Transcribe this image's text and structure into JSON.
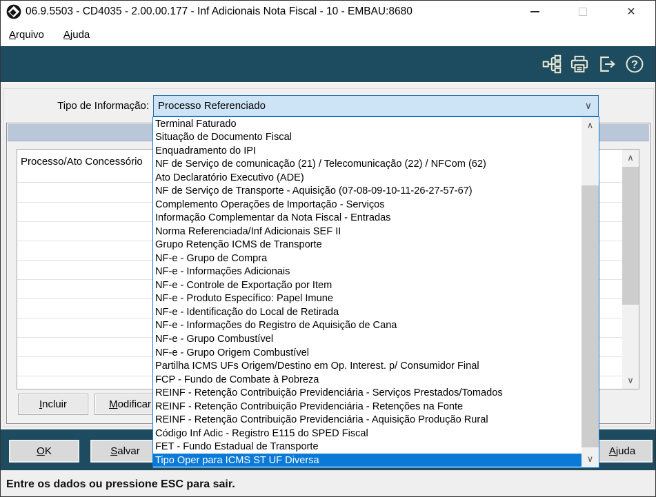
{
  "window": {
    "title": "06.9.5503 - CD4035 - 2.00.00.177 - Inf Adicionais Nota Fiscal - 10 - EMBAU:8680",
    "logo_icon": "totvs-logo-icon",
    "titlebar_icons": [
      "minimize-icon",
      "maximize-icon",
      "close-icon"
    ],
    "close_glyph": "×"
  },
  "menu": {
    "items": [
      {
        "label": "Arquivo"
      },
      {
        "label": "Ajuda"
      }
    ]
  },
  "toolbar": {
    "icons": [
      "program-tree-icon",
      "print-icon",
      "exit-icon",
      "help-icon"
    ],
    "help_glyph": "?"
  },
  "form": {
    "field_label": "Tipo de Informação:",
    "combo": {
      "value": "Processo Referenciado",
      "chevron_glyph": "∨"
    },
    "table": {
      "column_header": "Processo/Ato Concessório"
    },
    "actions": {
      "incluir": "Incluir",
      "modificar": "Modificar"
    }
  },
  "dropdown": {
    "items": [
      "Terminal Faturado",
      "Situação de Documento Fiscal",
      "Enquadramento do IPI",
      "NF de Serviço de comunicação (21) / Telecomunicação (22) / NFCom (62)",
      "Ato Declaratório Executivo (ADE)",
      "NF de Serviço de Transporte - Aquisição (07-08-09-10-11-26-27-57-67)",
      "Complemento Operações de Importação - Serviços",
      "Informação Complementar da Nota Fiscal - Entradas",
      "Norma Referenciada/Inf Adicionais SEF II",
      "Grupo Retenção ICMS de Transporte",
      "NF-e - Grupo de Compra",
      "NF-e - Informações Adicionais",
      "NF-e - Controle de Exportação por Item",
      "NF-e - Produto Específico: Papel Imune",
      "NF-e - Identificação do Local de Retirada",
      "NF-e - Informações do Registro de Aquisição de Cana",
      "NF-e - Grupo Combustível",
      "NF-e - Grupo Origem Combustível",
      "Partilha ICMS UFs Origem/Destino em Op. Interest. p/ Consumidor Final",
      "FCP - Fundo de Combate à Pobreza",
      "REINF - Retenção Contribuição Previdenciária - Serviços Prestados/Tomados",
      "REINF - Retenção Contribuição Previdenciária - Retenções na Fonte",
      "REINF - Retenção Contribuição Previdenciária - Aquisição Produção Rural",
      "Código Inf Adic - Registro E115 do SPED Fiscal",
      "FET - Fundo Estadual de Transporte",
      "Tipo Oper para ICMS ST UF Diversa"
    ],
    "selected_index": 25,
    "selected_value": "Tipo Oper para ICMS ST UF Diversa",
    "scroll_up_glyph": "∧",
    "scroll_down_glyph": "∨"
  },
  "footer": {
    "ok": "OK",
    "salvar": "Salvar",
    "ajuda": "Ajuda"
  },
  "statusbar": {
    "message": "Entre os dados ou pressione ESC para sair."
  },
  "colors": {
    "band_teal": "#1d4b5f",
    "icon_cream": "#ecead6",
    "combo_fill": "#cde4f7",
    "combo_border": "#2f6fad",
    "dropdown_border": "#0b7ad7",
    "selection_bg": "#0b7ad7",
    "selection_text": "#ffffff",
    "group_header_band": "#b9c7d8"
  }
}
